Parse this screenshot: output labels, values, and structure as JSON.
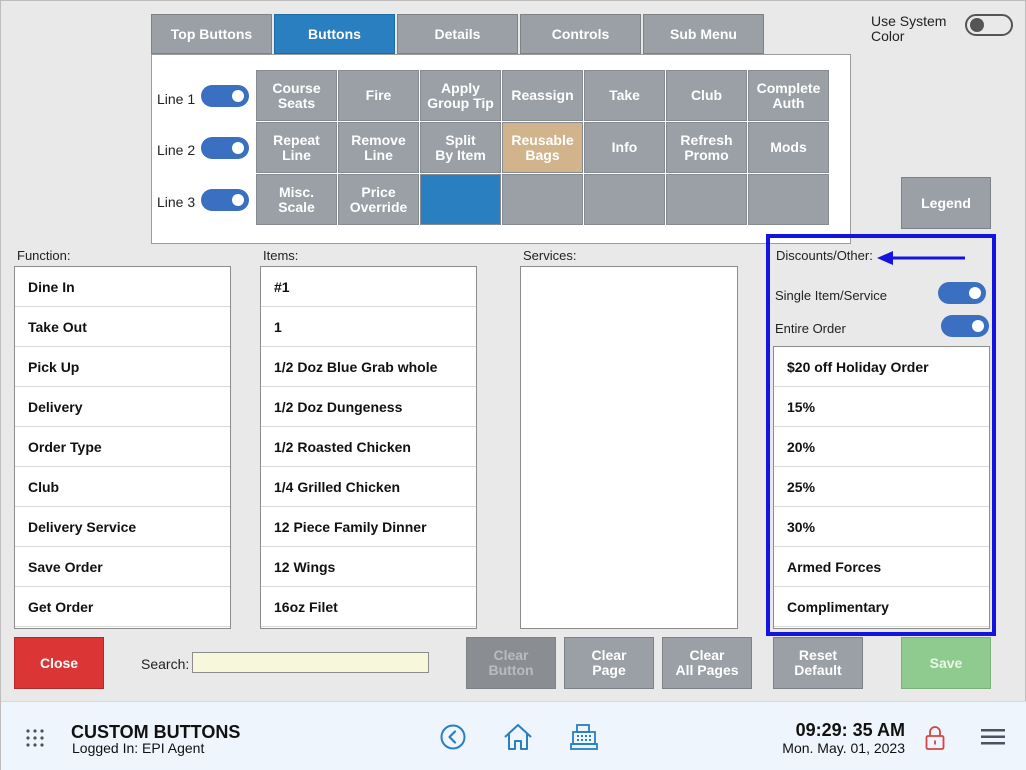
{
  "tabs": [
    {
      "label": "Top Buttons",
      "active": false
    },
    {
      "label": "Buttons",
      "active": true
    },
    {
      "label": "Details",
      "active": false
    },
    {
      "label": "Controls",
      "active": false
    },
    {
      "label": "Sub Menu",
      "active": false
    }
  ],
  "system_color": {
    "label_line1": "Use System",
    "label_line2": "Color",
    "enabled": false
  },
  "lines": [
    {
      "label": "Line 1",
      "enabled": true
    },
    {
      "label": "Line 2",
      "enabled": true
    },
    {
      "label": "Line 3",
      "enabled": true
    }
  ],
  "grid": {
    "row1": [
      {
        "l1": "Course",
        "l2": "Seats"
      },
      {
        "l1": "Fire",
        "l2": ""
      },
      {
        "l1": "Apply",
        "l2": "Group Tip"
      },
      {
        "l1": "Reassign",
        "l2": ""
      },
      {
        "l1": "Take",
        "l2": ""
      },
      {
        "l1": "Club",
        "l2": ""
      },
      {
        "l1": "Complete",
        "l2": "Auth"
      }
    ],
    "row2": [
      {
        "l1": "Repeat",
        "l2": "Line"
      },
      {
        "l1": "Remove",
        "l2": "Line"
      },
      {
        "l1": "Split",
        "l2": "By Item"
      },
      {
        "l1": "Reusable",
        "l2": "Bags"
      },
      {
        "l1": "Info",
        "l2": ""
      },
      {
        "l1": "Refresh",
        "l2": "Promo"
      },
      {
        "l1": "Mods",
        "l2": ""
      }
    ],
    "row3": [
      {
        "l1": "Misc.",
        "l2": "Scale"
      },
      {
        "l1": "Price",
        "l2": "Override"
      },
      {
        "l1": "",
        "l2": ""
      },
      {
        "l1": "",
        "l2": ""
      },
      {
        "l1": "",
        "l2": ""
      },
      {
        "l1": "",
        "l2": ""
      },
      {
        "l1": "",
        "l2": ""
      }
    ]
  },
  "legend_label": "Legend",
  "headers": {
    "function": "Function:",
    "items": "Items:",
    "services": "Services:",
    "discounts": "Discounts/Other:"
  },
  "function_list": [
    "Dine In",
    "Take Out",
    "Pick Up",
    "Delivery",
    "Order Type",
    "Club",
    "Delivery Service",
    "Save Order",
    "Get Order"
  ],
  "items_list": [
    "#1",
    "1",
    "1/2 Doz Blue Grab whole",
    "1/2 Doz Dungeness",
    "1/2 Roasted Chicken",
    "1/4 Grilled Chicken",
    "12 Piece Family Dinner",
    "12 Wings",
    "16oz Filet"
  ],
  "services_list": [],
  "discount_toggles": [
    {
      "label": "Single Item/Service",
      "enabled": true
    },
    {
      "label": "Entire Order",
      "enabled": true
    }
  ],
  "discounts_list": [
    "$20 off Holiday Order",
    "15%",
    "20%",
    "25%",
    "30%",
    "Armed Forces",
    "Complimentary"
  ],
  "actions": {
    "close": "Close",
    "search_label": "Search:",
    "search_value": "",
    "clear_button": {
      "l1": "Clear",
      "l2": "Button"
    },
    "clear_page": {
      "l1": "Clear",
      "l2": "Page"
    },
    "clear_all_pages": {
      "l1": "Clear",
      "l2": "All Pages"
    },
    "reset_default": {
      "l1": "Reset",
      "l2": "Default"
    },
    "save": "Save"
  },
  "footer": {
    "title": "CUSTOM BUTTONS",
    "logged_in": "Logged In:  EPI Agent",
    "time": "09:29: 35 AM",
    "date": "Mon. May. 01, 2023",
    "icons": [
      "apps-grid-icon",
      "back-circle-icon",
      "home-icon",
      "register-icon",
      "lock-icon",
      "hamburger-menu-icon"
    ]
  },
  "colors": {
    "accent_blue": "#2a7fc0",
    "toggle_blue": "#3a6fc2",
    "highlight_box": "#1414e0",
    "close_red": "#dc3535",
    "save_green": "#8fcb8f",
    "tan_button": "#d1b48c"
  }
}
